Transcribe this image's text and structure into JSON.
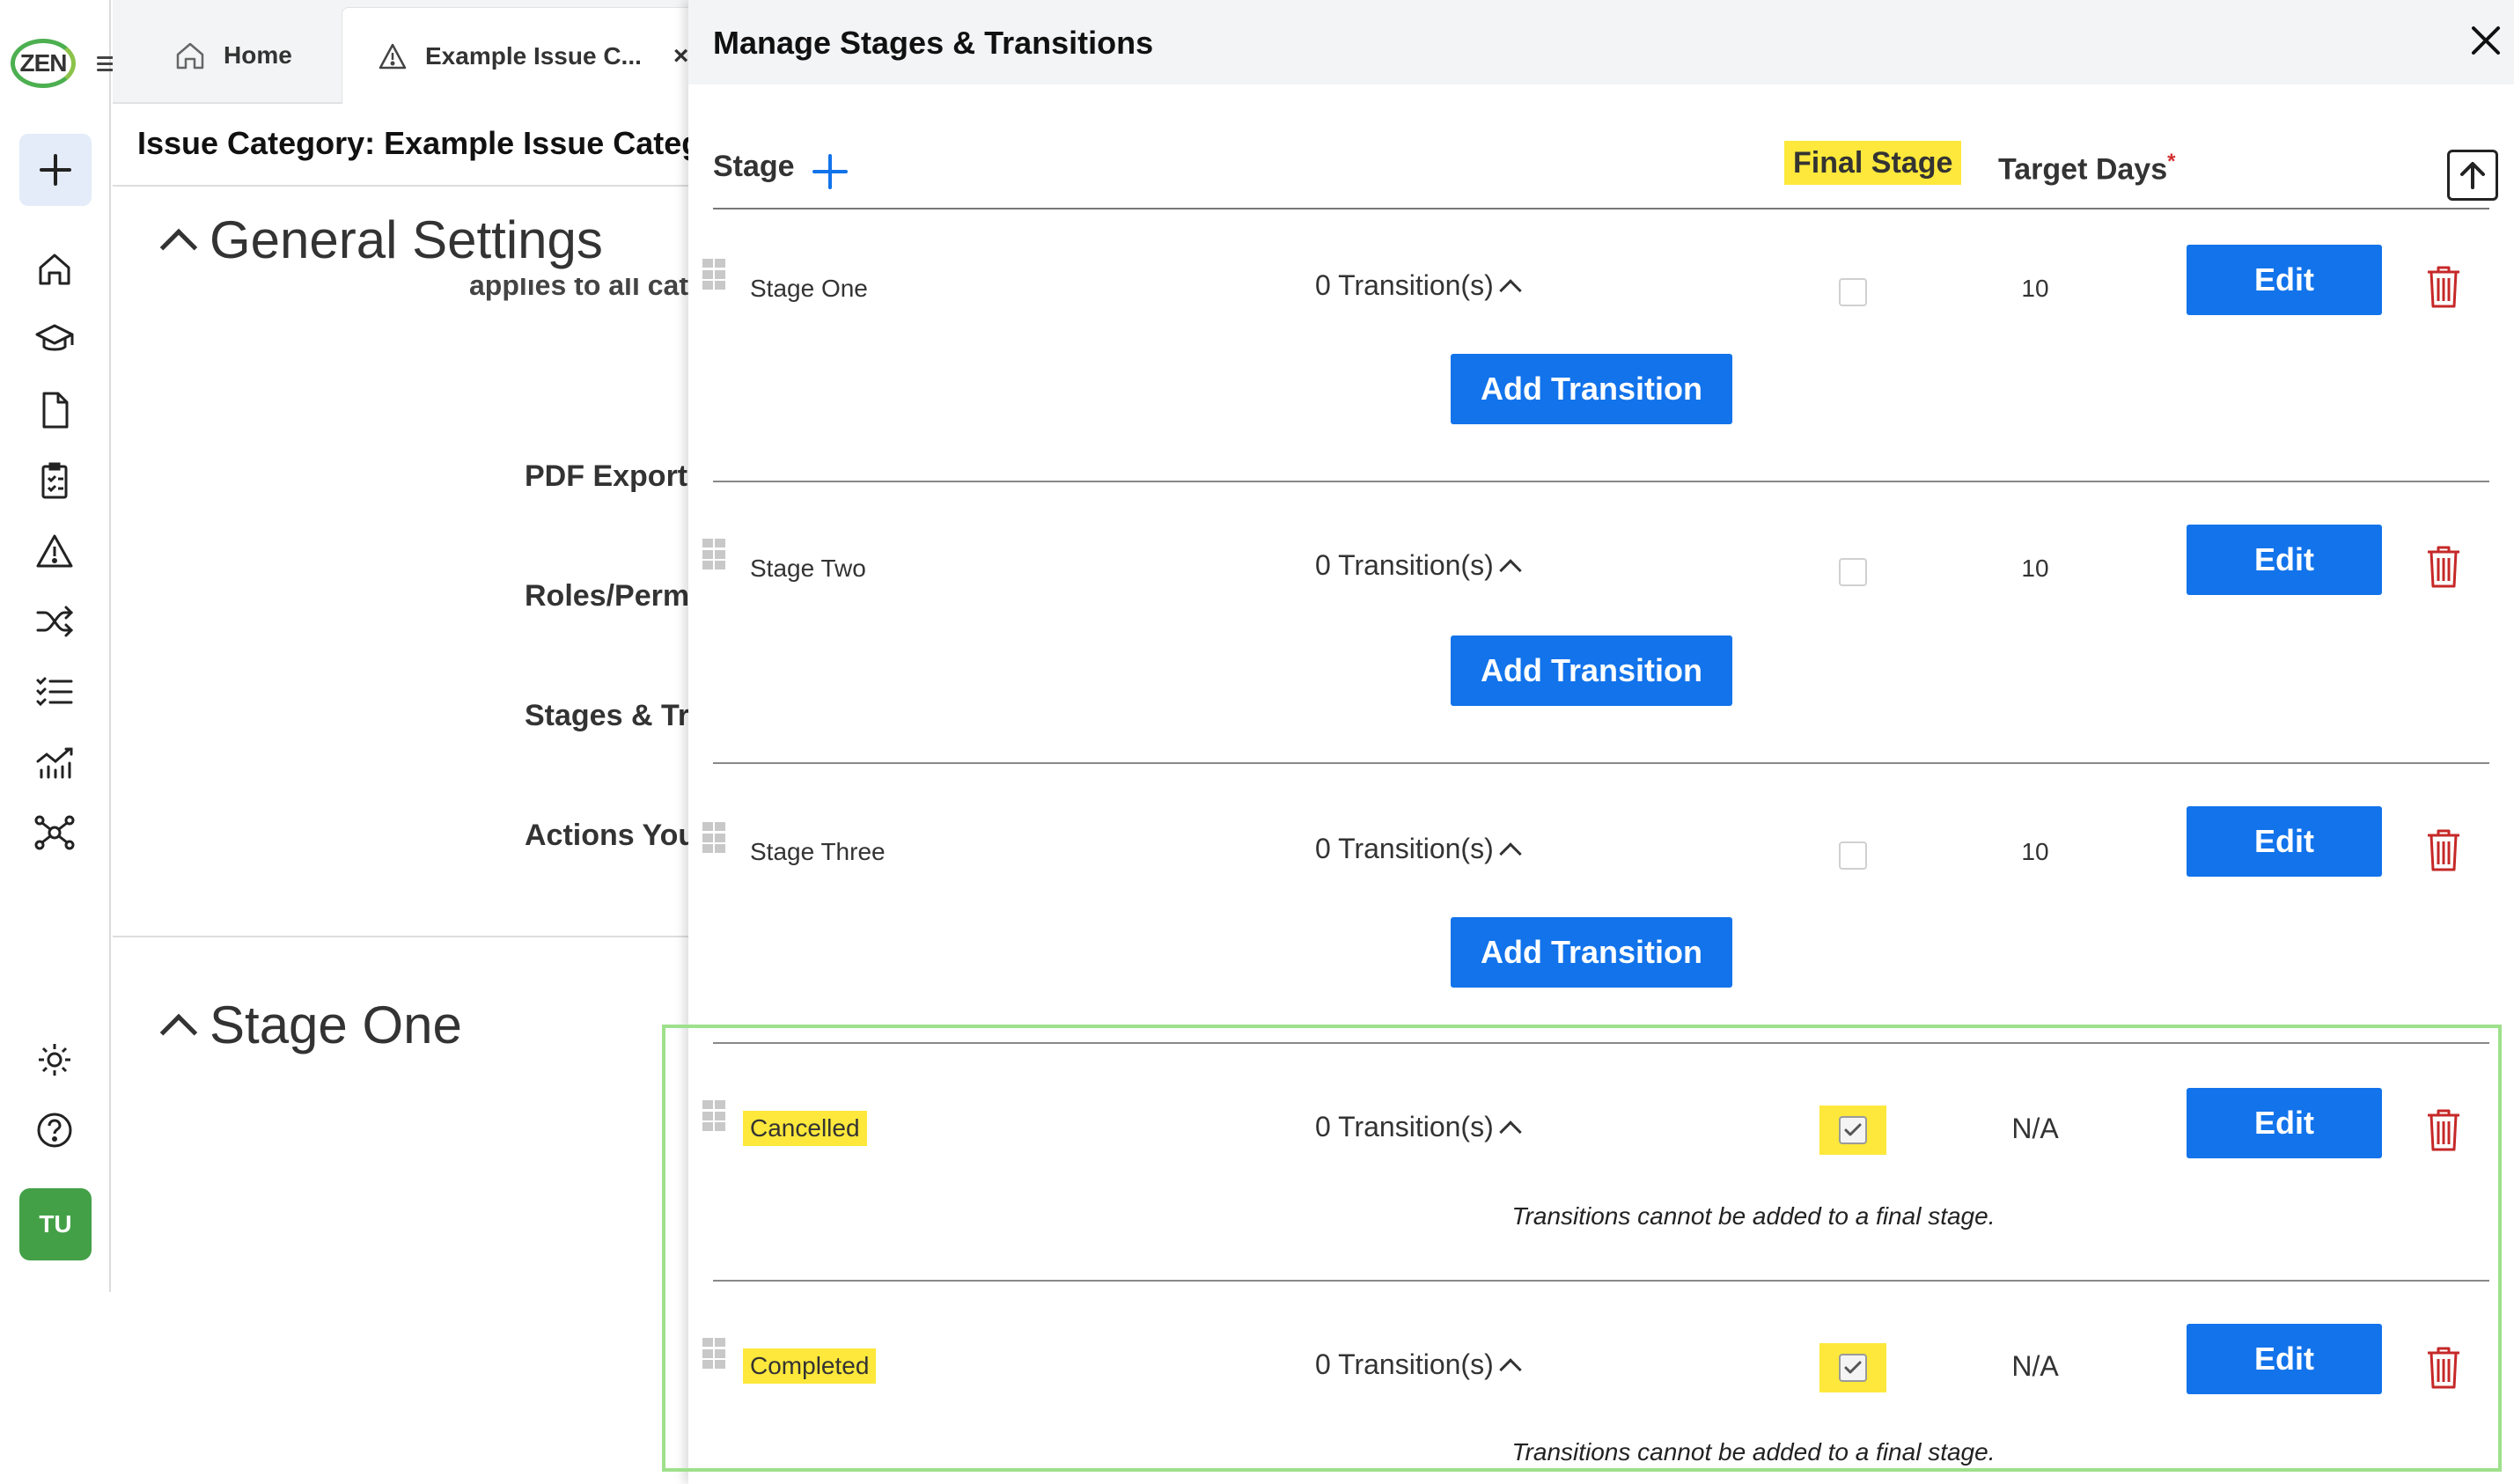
{
  "app": {
    "logo_text": "ZEN",
    "avatar_initials": "TU"
  },
  "tabs": [
    {
      "label": "Home",
      "icon": "home-icon"
    },
    {
      "label": "Example Issue C...",
      "icon": "warning-icon",
      "close": "×"
    }
  ],
  "background_page": {
    "issue_title": "Issue Category: Example Issue Category",
    "general_settings": "General Settings",
    "applies_text": "applies to all cat",
    "links": [
      "PDF Export (",
      "Roles/Permi",
      "Stages & Tra",
      "Actions You"
    ],
    "stage_section": "Stage One"
  },
  "panel": {
    "title": "Manage Stages & Transitions",
    "columns": {
      "stage": "Stage",
      "final_stage": "Final Stage",
      "target_days": "Target Days",
      "required_mark": "*"
    },
    "edit_label": "Edit",
    "add_transition_label": "Add Transition",
    "final_note": "Transitions cannot be added to a final stage.",
    "rows": [
      {
        "name": "Stage One",
        "transitions": "0 Transition(s)",
        "final": false,
        "target": "10"
      },
      {
        "name": "Stage Two",
        "transitions": "0 Transition(s)",
        "final": false,
        "target": "10"
      },
      {
        "name": "Stage Three",
        "transitions": "0 Transition(s)",
        "final": false,
        "target": "10"
      },
      {
        "name": "Cancelled",
        "transitions": "0 Transition(s)",
        "final": true,
        "target": "N/A"
      },
      {
        "name": "Completed",
        "transitions": "0 Transition(s)",
        "final": true,
        "target": "N/A"
      }
    ]
  },
  "colors": {
    "primary": "#1273eb",
    "highlight": "#fde83b",
    "delete": "#c62828",
    "frame": "#9ee08c"
  }
}
